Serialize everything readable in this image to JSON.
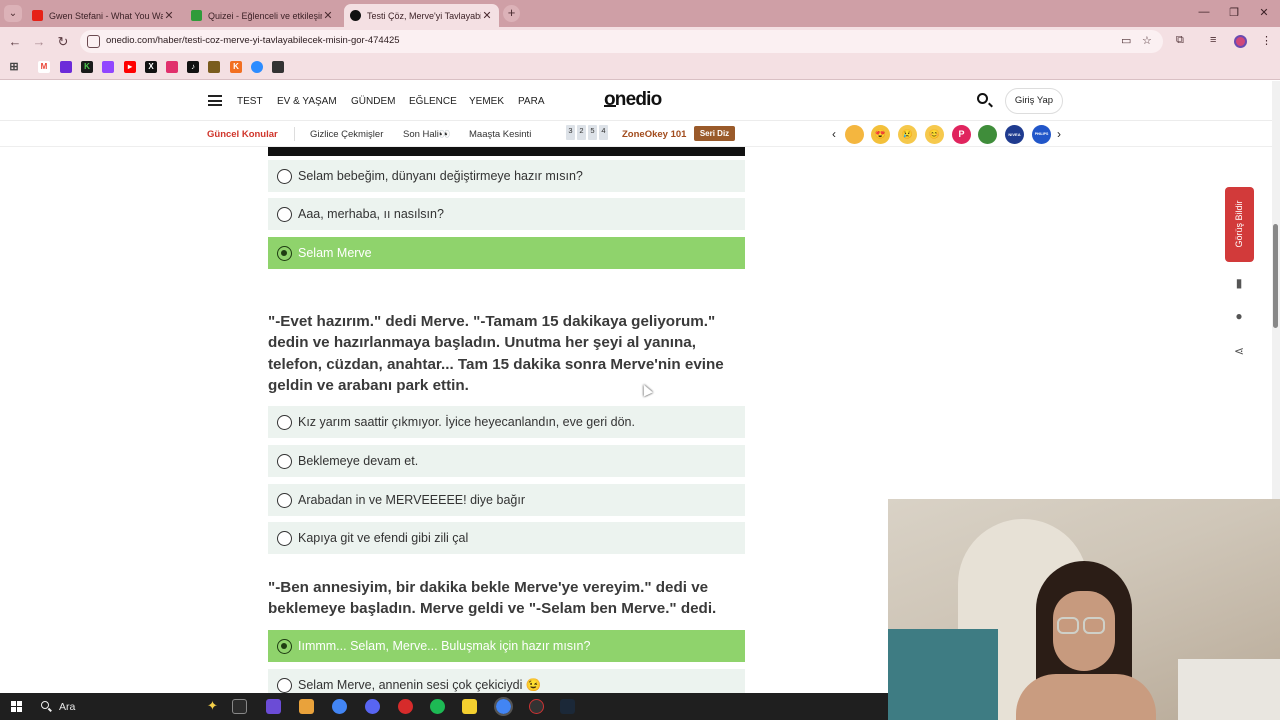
{
  "browser": {
    "tabs": [
      {
        "title": "Gwen Stefani - What You Waiti",
        "favicon_color": "#e62117"
      },
      {
        "title": "Quizei - Eğlenceli ve etkileşim",
        "favicon_color": "#2f9b3a"
      },
      {
        "title": "Testi Çöz, Merve'yi Tavlayabilec",
        "favicon_color": "#111111"
      }
    ],
    "url": "onedio.com/haber/testi-coz-merve-yi-tavlayabilecek-misin-gor-474425",
    "icons": {
      "back": "←",
      "forward": "→",
      "reload": "↻",
      "new_tab": "+",
      "close": "✕",
      "minimize": "—",
      "restore": "❐",
      "window_close": "✕",
      "star": "☆",
      "menu": "⋮",
      "tab_search": "⌄"
    },
    "bookmark_colors": [
      "#555555",
      "#ea4335",
      "#6c2bd9",
      "#1a1a1a",
      "#9146ff",
      "#ff0000",
      "#111111",
      "#e1306c",
      "#111111",
      "#7a5c1e",
      "#f26f21",
      "#2d8cff",
      "#333333"
    ],
    "bookmark_letters": [
      "",
      "M",
      "",
      "K",
      "",
      "",
      "X",
      "",
      "",
      "",
      "K",
      "",
      ""
    ]
  },
  "site": {
    "logo": "onedio",
    "nav": [
      "TEST",
      "EV & YAŞAM",
      "GÜNDEM",
      "EĞLENCE",
      "YEMEK",
      "PARA"
    ],
    "login": "Giriş Yap",
    "topics": {
      "hot": "Güncel Konular",
      "items": [
        "Gizlice Çekmişler",
        "Son Hali👀",
        "Maaşta Kesinti"
      ],
      "zone_digits": [
        "3",
        "2",
        "5",
        "4"
      ],
      "zone": "ZoneOkey 101",
      "badge": "Seri Diz",
      "prev": "‹",
      "next": "›",
      "emoji_colors": [
        "#f4b63f",
        "#f3c03a",
        "#f5c84b",
        "#f6c94d",
        "#e0245e",
        "#3f8d3a",
        "#1f3b8f",
        "#2156c9"
      ],
      "emoji_glyphs": [
        "",
        "😍",
        "😢",
        "😊",
        "P",
        "",
        "NIVEA",
        "PHILIPS"
      ]
    }
  },
  "quiz": {
    "q0_options": [
      {
        "label": "Selam bebeğim, dünyanı değiştirmeye hazır mısın?",
        "selected": false
      },
      {
        "label": "Aaa, merhaba, ıı nasılsın?",
        "selected": false
      },
      {
        "label": "Selam Merve",
        "selected": true
      }
    ],
    "q1": {
      "text": "\"-Evet hazırım.\" dedi Merve. \"-Tamam 15 dakikaya geliyorum.\" dedin ve hazırlanmaya başladın. Unutma her şeyi al yanına, telefon, cüzdan, anahtar... Tam 15 dakika sonra Merve'nin evine geldin ve arabanı park ettin.",
      "options": [
        {
          "label": "Kız yarım saattir çıkmıyor. İyice heyecanlandın, eve geri dön.",
          "selected": false
        },
        {
          "label": "Beklemeye devam et.",
          "selected": false
        },
        {
          "label": "Arabadan in ve MERVEEEEE! diye bağır",
          "selected": false
        },
        {
          "label": "Kapıya git ve efendi gibi zili çal",
          "selected": false
        }
      ]
    },
    "q2": {
      "text": "\"-Ben annesiyim, bir dakika bekle Merve'ye vereyim.\" dedi ve beklemeye başladın. Merve geldi ve \"-Selam ben Merve.\" dedi.",
      "options": [
        {
          "label": "Iımmm... Selam, Merve... Buluşmak için hazır mısın?",
          "selected": true
        },
        {
          "label": "Selam Merve, annenin sesi çok çekiciydi 😉",
          "selected": false
        }
      ]
    }
  },
  "side": {
    "feedback": "Görüş Bildir",
    "icons": [
      "bookmark-icon",
      "comments-icon",
      "share-icon"
    ]
  },
  "taskbar": {
    "search_placeholder": "Ara",
    "app_colors": [
      "#e9a23b",
      "#6b4cd6",
      "#d9a93a",
      "#4285f4",
      "#5865f2",
      "#d62b2b",
      "#1db954",
      "#f3cf2f",
      "#4285f4",
      "#333333",
      "#1b2838"
    ]
  }
}
